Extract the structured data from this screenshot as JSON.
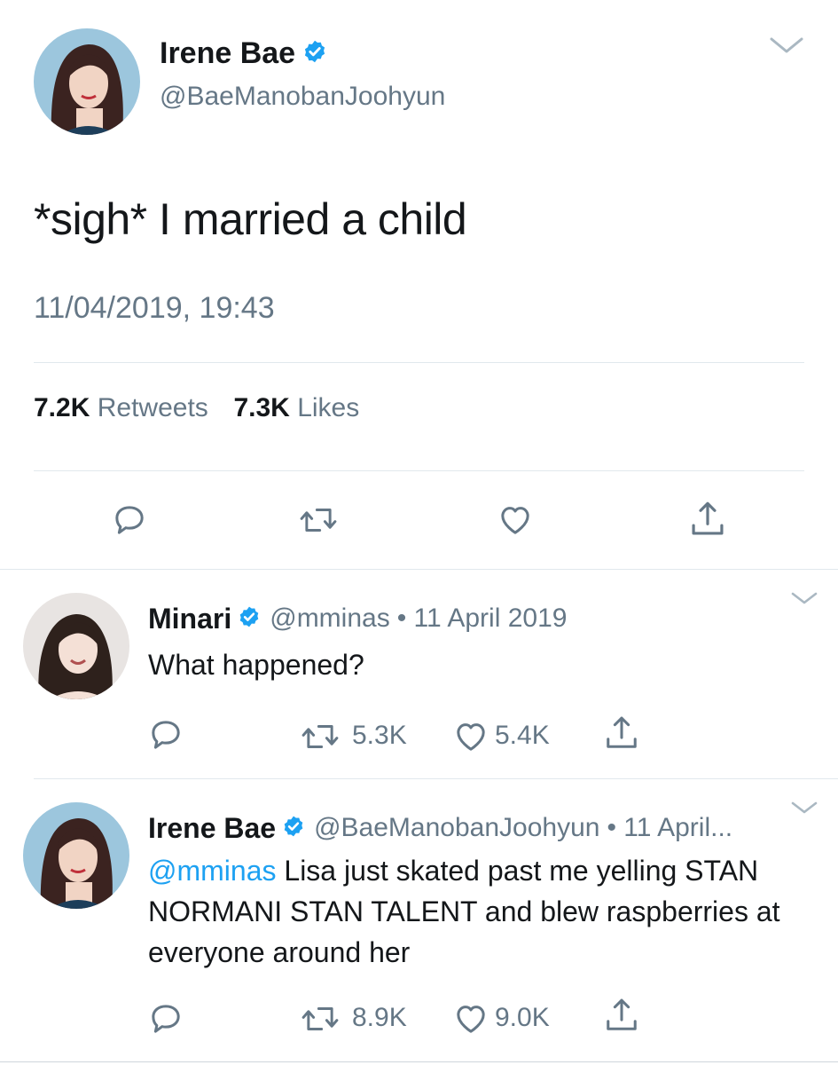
{
  "main_tweet": {
    "author_name": "Irene Bae",
    "author_handle": "@BaeManobanJoohyun",
    "text": "*sigh* I married a child",
    "timestamp": "11/04/2019, 19:43",
    "retweets_count": "7.2K",
    "retweets_label": "Retweets",
    "likes_count": "7.3K",
    "likes_label": "Likes"
  },
  "replies": [
    {
      "author_name": "Minari",
      "author_handle": "@mminas",
      "meta": "• 11 April 2019",
      "text": "What happened?",
      "retweets": "5.3K",
      "likes": "5.4K"
    },
    {
      "author_name": "Irene Bae",
      "author_handle": "@BaeManobanJoohyun",
      "meta": "• 11 April...",
      "mention": "@mminas",
      "text": " Lisa just skated past me yelling STAN NORMANI STAN TALENT and blew raspberries at everyone around her",
      "retweets": "8.9K",
      "likes": "9.0K"
    }
  ],
  "icons": {
    "verified": "verified-badge-icon",
    "chevron": "chevron-down-icon",
    "reply": "reply-icon",
    "retweet": "retweet-icon",
    "like": "heart-icon",
    "share": "share-icon"
  },
  "colors": {
    "accent": "#1da1f2",
    "secondary_text": "#657786",
    "divider": "#e1e8ed"
  }
}
